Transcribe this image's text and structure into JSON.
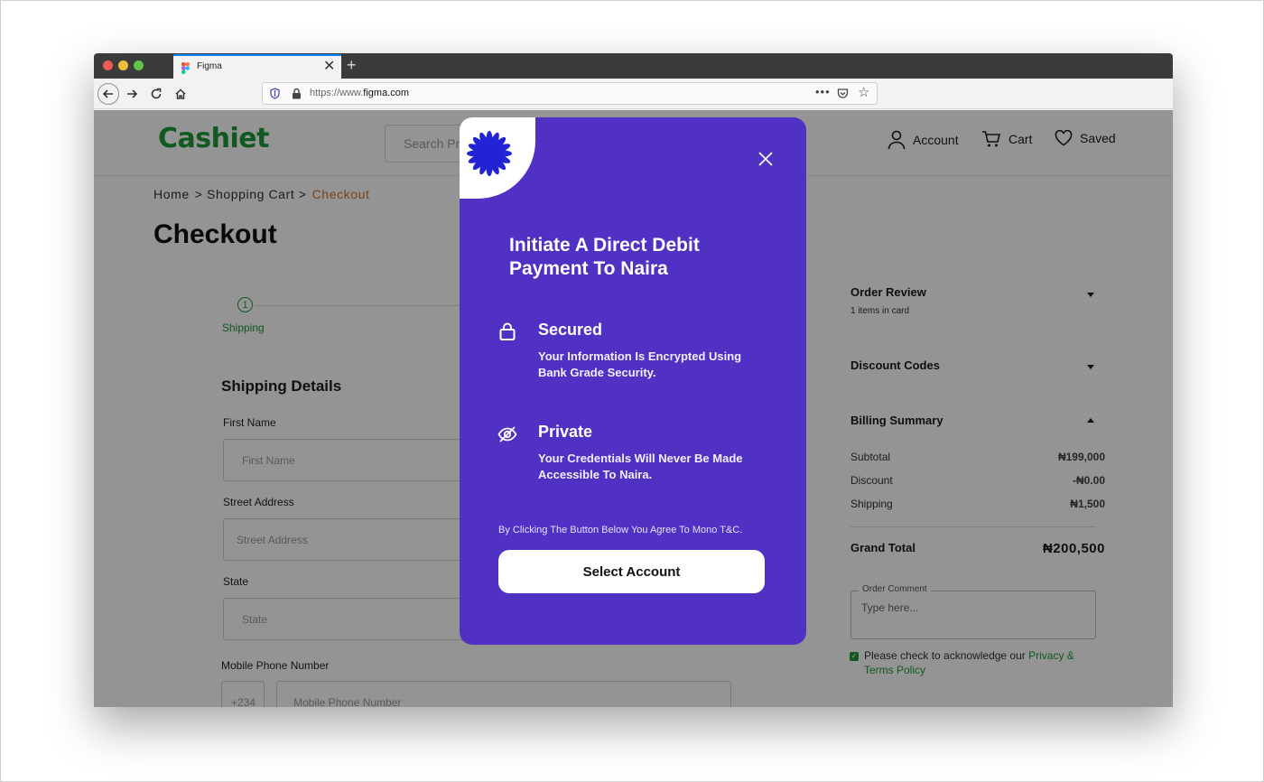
{
  "browser": {
    "tab_title": "Figma",
    "new_tab": "+",
    "tab_close": "✕",
    "url_prefix": "https://www.",
    "url_domain": "figma.com",
    "more": "•••"
  },
  "header": {
    "logo": "Cashiet",
    "search_placeholder": "Search Pr",
    "account": "Account",
    "cart": "Cart",
    "saved": "Saved"
  },
  "breadcrumb": {
    "home": "Home",
    "cart": "> Shopping Cart >",
    "current": "Checkout"
  },
  "page_title": "Checkout",
  "form": {
    "step_number": "1",
    "step_label": "Shipping",
    "section_title": "Shipping Details",
    "first_name_label": "First Name",
    "first_name_placeholder": "First Name",
    "street_label": "Street Address",
    "street_placeholder": "Street Address",
    "state_label": "State",
    "state_placeholder": "State",
    "phone_label": "Mobile Phone Number",
    "phone_code": "+234",
    "phone_placeholder": "Mobile Phone Number"
  },
  "sidebar": {
    "order_review": {
      "title": "Order Review",
      "subtitle": "1 items in card"
    },
    "discount": {
      "title": "Discount Codes"
    },
    "billing": {
      "title": "Billing Summary",
      "rows": [
        {
          "label": "Subtotal",
          "value": "₦199,000"
        },
        {
          "label": "Discount",
          "value": "-₦0.00"
        },
        {
          "label": "Shipping",
          "value": "₦1,500"
        }
      ],
      "grand_total_label": "Grand Total",
      "grand_total_value": "₦200,500",
      "comment_legend": "Order Comment",
      "comment_placeholder": "Type here...",
      "ack_text": "Please check to acknowledge our ",
      "ack_link": "Privacy & Terms Policy",
      "ack_checked": true
    }
  },
  "modal": {
    "title": "Initiate A Direct Debit Payment To Naira",
    "features": [
      {
        "icon": "lock-icon",
        "title": "Secured",
        "text": "Your Information Is Encrypted Using  Bank Grade Security."
      },
      {
        "icon": "eye-off-icon",
        "title": "Private",
        "text": "Your Credentials Will Never Be Made Accessible To Naira."
      }
    ],
    "terms": "By Clicking The Button Below You Agree To Mono T&C.",
    "button": "Select Account",
    "accent": "#5130c4"
  },
  "colors": {
    "brand_green": "#1f9a3a",
    "breadcrumb_active": "#d3722a"
  }
}
